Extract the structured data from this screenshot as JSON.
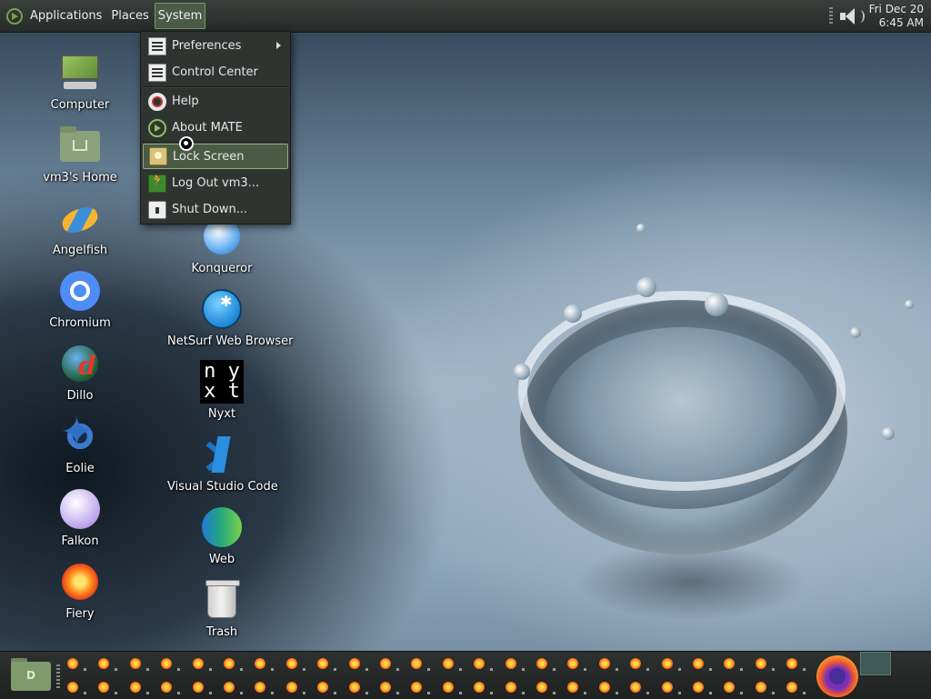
{
  "top_panel": {
    "menus": [
      "Applications",
      "Places",
      "System"
    ],
    "active_menu": "System",
    "clock": {
      "date": "Fri Dec 20",
      "time": "6:45 AM"
    }
  },
  "system_menu": {
    "items": [
      {
        "label": "Preferences",
        "icon": "preferences-icon",
        "has_submenu": true
      },
      {
        "label": "Control Center",
        "icon": "control-center-icon"
      },
      {
        "label": "Help",
        "icon": "help-icon"
      },
      {
        "label": "About MATE",
        "icon": "mate-logo-icon"
      },
      {
        "label": "Lock Screen",
        "icon": "lock-screen-icon",
        "highlighted": true
      },
      {
        "label": "Log Out vm3...",
        "icon": "log-out-icon"
      },
      {
        "label": "Shut Down...",
        "icon": "shutdown-icon"
      }
    ]
  },
  "desktop": {
    "left_column": [
      {
        "label": "Computer",
        "icon": "computer-icon"
      },
      {
        "label": "vm3's Home",
        "icon": "home-folder-icon"
      },
      {
        "label": "Angelfish",
        "icon": "angelfish-icon"
      },
      {
        "label": "Chromium",
        "icon": "chromium-icon"
      },
      {
        "label": "Dillo",
        "icon": "dillo-icon"
      },
      {
        "label": "Eolie",
        "icon": "eolie-icon"
      },
      {
        "label": "Falkon",
        "icon": "falkon-icon"
      },
      {
        "label": "Fiery",
        "icon": "fiery-icon"
      }
    ],
    "right_column": [
      {
        "label": "Konqueror",
        "icon": "konqueror-icon"
      },
      {
        "label": "NetSurf Web Browser",
        "icon": "netsurf-icon"
      },
      {
        "label": "Nyxt",
        "icon": "nyxt-icon",
        "icon_text": [
          "n y",
          "x t"
        ]
      },
      {
        "label": "Visual Studio Code",
        "icon": "vscode-icon"
      },
      {
        "label": "Web",
        "icon": "web-icon"
      },
      {
        "label": "Trash",
        "icon": "trash-icon"
      }
    ]
  },
  "bottom_panel": {
    "launchers": [
      "file-manager-icon",
      "firefox-icon"
    ],
    "file_manager_letter": "D",
    "window_items": 48
  },
  "colors": {
    "panel": "#262a28",
    "menu_bg": "#2f3431",
    "highlight": "#4a5b45",
    "highlight_border": "#8fb077"
  }
}
